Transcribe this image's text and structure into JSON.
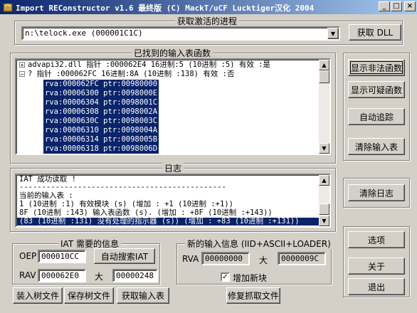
{
  "window": {
    "title": "Import REConstructor v1.6 最终版 (C) MackT/uCF Lucktiger汉化 2004",
    "min_symbol": "_",
    "max_symbol": "□",
    "close_symbol": "×"
  },
  "process": {
    "group_label": "获取激活的进程",
    "selected": "n:\\telock.exe (000001C1C)",
    "get_dll_label": "获取 DLL"
  },
  "imports": {
    "group_label": "已找到的输入表函数",
    "tree": [
      {
        "expander": "+",
        "text": "advapi32.dll 指针 :000062E4 16进制:5 (10进制 :5) 有效 :是"
      },
      {
        "expander": "−",
        "text": "? 指针 :000062FC 16进制:8A (10进制 :138) 有效 :否"
      }
    ],
    "rows": [
      "rva:000062FC ptr:00980000",
      "rva:00006300 ptr:0098000E",
      "rva:00006304 ptr:0098001C",
      "rva:00006308 ptr:0098002A",
      "rva:0000630C ptr:0098003C",
      "rva:00006310 ptr:0098004A",
      "rva:00006314 ptr:0098005B",
      "rva:00006318 ptr:0098006D"
    ]
  },
  "side_buttons": {
    "show_invalid": "显示非法函数",
    "show_suspect": "显示可疑函数",
    "auto_trace": "自动追踪",
    "clear_imports": "清除输入表",
    "clear_log": "清除日志",
    "options": "选项",
    "about": "关于",
    "exit": "退出"
  },
  "log": {
    "group_label": "日志",
    "lines": [
      "IAT 成功读取 !",
      "----------------------------------------------",
      "当前的输入表 :",
      "1 (10进制 :1) 有效模块     (s) (增加 : +1 (10进制 :+1))",
      "8F (10进制 :143) 输入表函数       (s). (增加 : +8F (10进制 :+143))",
      "(83 (10进制 :131) 没有处理的指示器  (s)) (增加 : +83 (10进制 :+131))"
    ]
  },
  "iat": {
    "group_label": "IAT 需要的信息",
    "oep_label": "OEP",
    "oep_value": "000010CC",
    "auto_search_label": "自动搜索IAT",
    "rva_label": "RAV",
    "rva_value": "000062E0",
    "size_label": "大",
    "size_value": "00000248"
  },
  "new_import": {
    "group_label": "新的输入信息 (IID+ASCII+LOADER)",
    "rva_label": "RVA",
    "rva_value": "00000000",
    "size_label": "大",
    "size_value": "0000009C",
    "add_section_label": "增加新块",
    "add_section_checked": "✓"
  },
  "bottom_buttons": {
    "load_tree": "装入树文件",
    "save_tree": "保存树文件",
    "get_imports": "获取输入表",
    "fix_dump": "修复抓取文件"
  }
}
